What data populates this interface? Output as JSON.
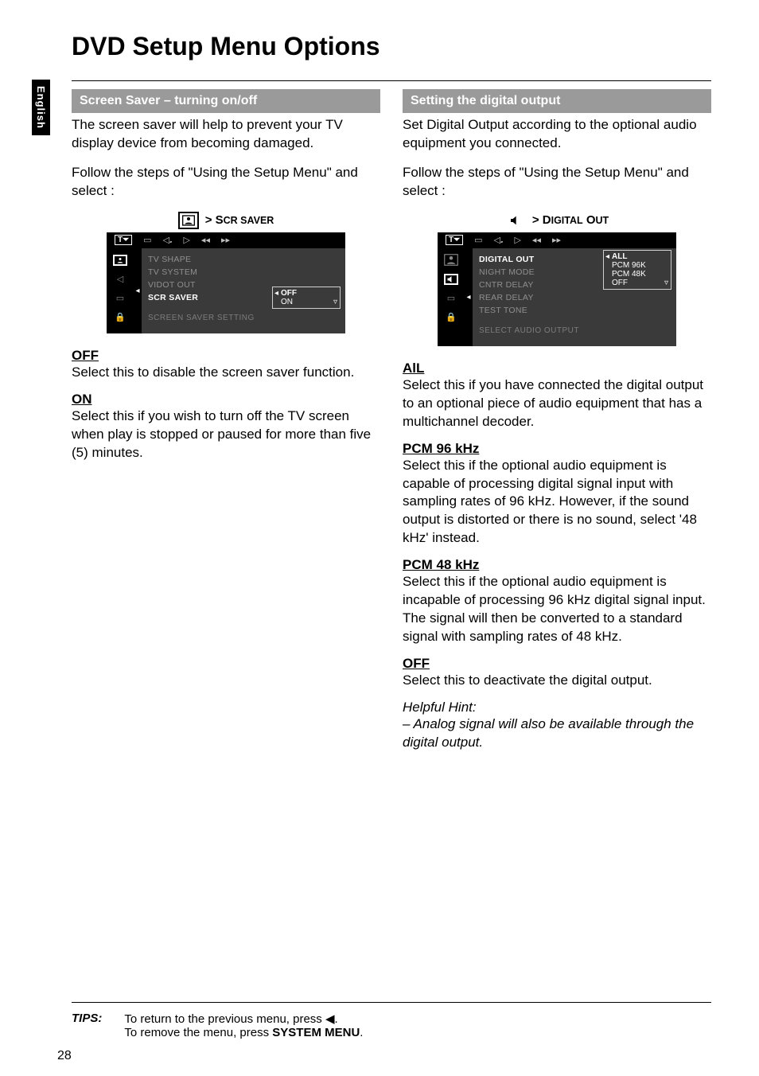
{
  "language_tab": "English",
  "page_title": "DVD Setup Menu Options",
  "page_number": "28",
  "footer": {
    "tips_label": "TIPS:",
    "line1_pre": "To return to the previous menu, press ",
    "line1_post": ".",
    "line2_pre": "To remove the menu, press ",
    "line2_bold": "SYSTEM MENU",
    "line2_post": "."
  },
  "left": {
    "section_title": "Screen Saver – turning on/off",
    "intro": "The screen saver will help to prevent your TV display device from becoming damaged.",
    "follow": "Follow the steps of \"Using the Setup Menu\" and select :",
    "crumb_prefix": "> ",
    "crumb_main": "S",
    "crumb_rest": "CR SAVER",
    "osd": {
      "top_selected": "T␣",
      "menu_items": [
        "TV SHAPE",
        "TV SYSTEM",
        "VIDOT OUT",
        "SCR SAVER"
      ],
      "active_index": 3,
      "sub_options": [
        "OFF",
        "ON"
      ],
      "sub_selected_index": 0,
      "hint": "SCREEN SAVER SETTING"
    },
    "terms": [
      {
        "title": "OFF",
        "body": "Select this to disable the screen saver function."
      },
      {
        "title": "ON",
        "body": "Select this if you wish to turn off the TV screen when play is stopped or paused for more than five (5) minutes."
      }
    ]
  },
  "right": {
    "section_title": "Setting the digital output",
    "intro": "Set Digital Output according to the optional audio equipment you connected.",
    "follow": "Follow the steps of \"Using the Setup Menu\" and select :",
    "crumb_prefix": "> ",
    "crumb_main": "D",
    "crumb_rest_a": "IGITAL",
    "crumb_mid": " O",
    "crumb_rest_b": "UT",
    "osd": {
      "top_selected": "T␣",
      "menu_items": [
        "DIGITAL OUT",
        "NIGHT MODE",
        "CNTR DELAY",
        "REAR DELAY",
        "TEST TONE"
      ],
      "active_index": 0,
      "sub_options": [
        "ALL",
        "PCM 96K",
        "PCM 48K",
        "OFF"
      ],
      "sub_selected_index": 0,
      "hint": "SELECT AUDIO OUTPUT"
    },
    "terms": [
      {
        "title": "AlL",
        "body": "Select this if you have connected the digital output to an optional piece of audio equipment that has a multichannel decoder."
      },
      {
        "title": "PCM 96 kHz",
        "body": "Select this if the optional audio equipment is capable of processing digital signal input with sampling rates of 96 kHz. However, if the sound output is distorted or there is no sound, select '48 kHz' instead."
      },
      {
        "title": "PCM 48 kHz",
        "body": "Select this if the optional audio equipment is incapable of processing 96 kHz digital signal input.  The signal will then be converted to a standard signal with sampling rates of 48 kHz."
      },
      {
        "title": "OFF",
        "body": "Select this to deactivate the digital output."
      }
    ],
    "hint_title": "Helpful Hint:",
    "hint_body": "– Analog signal will also be available through the digital output."
  }
}
